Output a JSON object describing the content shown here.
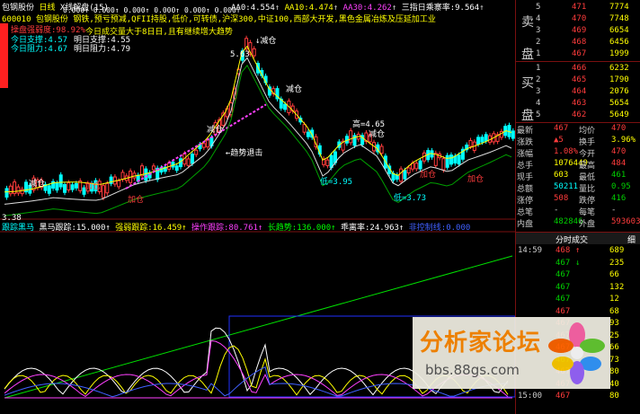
{
  "header": {
    "stock_name": "包钢股份",
    "period": "日线",
    "indicator": "X线解盘(15)",
    "ma": [
      {
        "label": "AA0:",
        "value": "4.554"
      },
      {
        "label": "AA10:",
        "value": "4.474"
      },
      {
        "label": "AA30:",
        "value": "4.262"
      },
      {
        "label": "三指日乘寨率:",
        "value": "9.564"
      }
    ],
    "zeros": [
      "0.000",
      "0.000",
      "0.000",
      "0.000",
      "0.000",
      "0.000",
      "0.000",
      "0.000",
      "0.000",
      "0.000"
    ],
    "concepts": "600010 包钢股份  钢铁,预亏预减,QFII持股,低价,可转债,沪深300,中证100,西部大开发,黑色金属冶炼及压延加工业"
  },
  "info_box": {
    "title": "操盘强弱度:98.92%",
    "support_today_label": "今日支撑:",
    "support_today": "4.57",
    "resist_today_label": "今日阻力:",
    "resist_today": "4.67",
    "support_tom_label": "明日支撑:",
    "support_tom": "4.55",
    "resist_tom_label": "明日阻力:",
    "resist_tom": "4.79",
    "advice": "今日成交量大于8日日,且有继续增大趋势"
  },
  "chart_labels": {
    "high_price": "5.63",
    "peak_label": "↓减仓",
    "mid_high": "高=4.65",
    "low1": "低=3.95",
    "low2": "低=3.73",
    "axis_low": "3.38",
    "jian_cang": "←减仓",
    "jia_cang": "↑加仓",
    "trend_label": "←趋势退击",
    "add_labels": [
      "加仓",
      "加仓",
      "加仓",
      "加仓"
    ],
    "reduce_labels": [
      "减仓",
      "减仓",
      "减仓",
      "减仓"
    ]
  },
  "sub_header": [
    {
      "label": "跟踪黑马",
      "value": "",
      "color": "#00ffff"
    },
    {
      "label": "黑马跟踪:",
      "value": "15.000↑",
      "color": "#ffffff"
    },
    {
      "label": "强弱跟踪:",
      "value": "16.459↑",
      "color": "#ffff00"
    },
    {
      "label": "操作跟踪:",
      "value": "80.761↑",
      "color": "#ff40ff"
    },
    {
      "label": "长趋势:",
      "value": "136.000↑",
      "color": "#00ff00"
    },
    {
      "label": "乖离率:",
      "value": "24.963↑",
      "color": "#ffffff"
    },
    {
      "label": "非控制线:",
      "value": "0.000",
      "color": "#4060ff"
    }
  ],
  "orderbook": {
    "sell_label": [
      "卖",
      "盘"
    ],
    "buy_label": [
      "买",
      "盘"
    ],
    "sell": [
      {
        "lvl": "5",
        "price": "471",
        "vol": "7774"
      },
      {
        "lvl": "4",
        "price": "470",
        "vol": "7748"
      },
      {
        "lvl": "3",
        "price": "469",
        "vol": "6654"
      },
      {
        "lvl": "2",
        "price": "468",
        "vol": "6456"
      },
      {
        "lvl": "1",
        "price": "467",
        "vol": "1999"
      }
    ],
    "buy": [
      {
        "lvl": "1",
        "price": "466",
        "vol": "6232"
      },
      {
        "lvl": "2",
        "price": "465",
        "vol": "1790"
      },
      {
        "lvl": "3",
        "price": "464",
        "vol": "2076"
      },
      {
        "lvl": "4",
        "price": "463",
        "vol": "5654"
      },
      {
        "lvl": "5",
        "price": "462",
        "vol": "5649"
      }
    ]
  },
  "quote": [
    {
      "l": "最新",
      "v": "467",
      "l2": "均价",
      "v2": "470",
      "c": "#ff3c3c",
      "c2": "#ff3c3c"
    },
    {
      "l": "涨跌",
      "v": "▲5",
      "l2": "换手",
      "v2": "3.96%",
      "c": "#ff3c3c",
      "c2": "#ffff00"
    },
    {
      "l": "涨幅",
      "v": "1.08%",
      "l2": "今开",
      "v2": "470",
      "c": "#ff3c3c",
      "c2": "#ff3c3c"
    },
    {
      "l": "总手",
      "v": "1076449",
      "l2": "最高",
      "v2": "484",
      "c": "#ffff00",
      "c2": "#ff3c3c"
    },
    {
      "l": "现手",
      "v": "603",
      "l2": "最低",
      "v2": "461",
      "c": "#ffff00",
      "c2": "#00d000"
    },
    {
      "l": "总额",
      "v": "50211",
      "l2": "量比",
      "v2": "0.95",
      "c": "#00ffff",
      "c2": "#00d000"
    },
    {
      "l": "涨停",
      "v": "508",
      "l2": "跌停",
      "v2": "416",
      "c": "#ff3c3c",
      "c2": "#00d000"
    },
    {
      "l": "总笔",
      "v": "-",
      "l2": "每笔",
      "v2": "-",
      "c": "#ccc",
      "c2": "#ccc"
    },
    {
      "l": "内盘",
      "v": "482846",
      "l2": "外盘",
      "v2": "593603",
      "c": "#00d000",
      "c2": "#ff3c3c"
    }
  ],
  "ticks_title": "分时成交",
  "ticks_title2": "细",
  "ticks": [
    {
      "t": "14:59",
      "p": "468",
      "arrow": "↑",
      "v": "689",
      "c": "#ff3c3c"
    },
    {
      "t": "",
      "p": "467",
      "arrow": "↓",
      "v": "235",
      "c": "#00d000"
    },
    {
      "t": "",
      "p": "467",
      "arrow": "",
      "v": "66",
      "c": "#00d000"
    },
    {
      "t": "",
      "p": "467",
      "arrow": "",
      "v": "132",
      "c": "#00d000"
    },
    {
      "t": "",
      "p": "467",
      "arrow": "",
      "v": "12",
      "c": "#00d000"
    },
    {
      "t": "",
      "p": "467",
      "arrow": "",
      "v": "68",
      "c": "#ff3c3c"
    },
    {
      "t": "",
      "p": "467",
      "arrow": "",
      "v": "93",
      "c": "#ff3c3c"
    },
    {
      "t": "",
      "p": "467",
      "arrow": "",
      "v": "25",
      "c": "#ff3c3c"
    },
    {
      "t": "",
      "p": "467",
      "arrow": "",
      "v": "66",
      "c": "#ff3c3c"
    },
    {
      "t": "",
      "p": "467",
      "arrow": "",
      "v": "73",
      "c": "#00d000"
    },
    {
      "t": "",
      "p": "467",
      "arrow": "",
      "v": "80",
      "c": "#ff3c3c"
    },
    {
      "t": "",
      "p": "467",
      "arrow": "",
      "v": "40",
      "c": "#ff3c3c"
    },
    {
      "t": "15:00",
      "p": "467",
      "arrow": "",
      "v": "80",
      "c": "#ff3c3c"
    }
  ],
  "watermark": {
    "title": "分析家论坛",
    "url": "bbs.88gs.com"
  }
}
